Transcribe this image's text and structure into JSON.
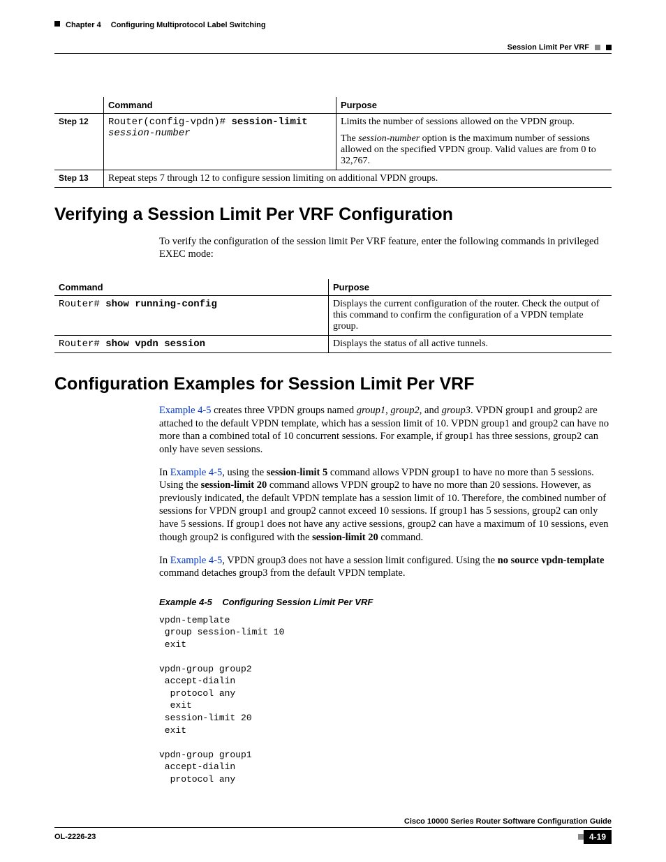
{
  "header": {
    "chapter": "Chapter 4",
    "title": "Configuring Multiprotocol Label Switching",
    "section": "Session Limit Per VRF"
  },
  "table1": {
    "headers": {
      "command": "Command",
      "purpose": "Purpose"
    },
    "rows": [
      {
        "step": "Step 12",
        "command_prefix": "Router(config-vpdn)# ",
        "command_bold": "session-limit",
        "command_italic": "session-number",
        "purpose_line1": "Limits the number of sessions allowed on the VPDN group.",
        "purpose_line2a": "The ",
        "purpose_line2b": "session-number",
        "purpose_line2c": " option is the maximum number of sessions allowed on the specified VPDN group. Valid values are from 0 to 32,767."
      },
      {
        "step": "Step 13",
        "merged": "Repeat steps 7 through 12 to configure session limiting on additional VPDN groups."
      }
    ]
  },
  "h2a": "Verifying a Session Limit Per VRF Configuration",
  "para1": "To verify the configuration of the session limit Per VRF feature, enter the following commands in privileged EXEC mode:",
  "table2": {
    "headers": {
      "command": "Command",
      "purpose": "Purpose"
    },
    "rows": [
      {
        "command_prefix": "Router# ",
        "command_bold": "show running-config",
        "purpose": "Displays the current configuration of the router. Check the output of this command to confirm the configuration of a VPDN template group."
      },
      {
        "command_prefix": "Router# ",
        "command_bold": "show vpdn session",
        "purpose": "Displays the status of all active tunnels."
      }
    ]
  },
  "h2b": "Configuration Examples for Session Limit Per VRF",
  "para2": {
    "link": "Example 4-5",
    "rest_a": " creates three VPDN groups named ",
    "i1": "group1",
    "c1": ", ",
    "i2": "group2",
    "c2": ", and ",
    "i3": "group3",
    "rest_b": ". VPDN group1 and group2 are attached to the default VPDN template, which has a session limit of 10. VPDN group1 and group2 can have no more than a combined total of 10 concurrent sessions. For example, if group1 has three sessions, group2 can only have seven sessions."
  },
  "para3": {
    "a": "In ",
    "link": "Example 4-5",
    "b": ", using the ",
    "bold1": "session-limit 5",
    "c": " command allows VPDN group1 to have no more than 5 sessions. Using the ",
    "bold2": "session-limit 20",
    "d": " command allows VPDN group2 to have no more than 20 sessions. However, as previously indicated, the default VPDN template has a session limit of 10. Therefore, the combined number of sessions for VPDN group1 and group2 cannot exceed 10 sessions. If group1 has 5 sessions, group2 can only have 5 sessions. If group1 does not have any active sessions, group2 can have a maximum of 10 sessions, even though group2 is configured with the ",
    "bold3": "session-limit 20",
    "e": " command."
  },
  "para4": {
    "a": "In ",
    "link": "Example 4-5",
    "b": ", VPDN group3 does not have a session limit configured. Using the ",
    "bold1": "no source vpdn-template",
    "c": " command detaches group3 from the default VPDN template."
  },
  "example": {
    "label": "Example 4-5",
    "title": "Configuring Session Limit Per VRF",
    "code": "vpdn-template\n group session-limit 10\n exit\n\nvpdn-group group2\n accept-dialin\n  protocol any\n  exit\n session-limit 20\n exit\n\nvpdn-group group1\n accept-dialin\n  protocol any"
  },
  "footer": {
    "book": "Cisco 10000 Series Router Software Configuration Guide",
    "doc": "OL-2226-23",
    "page": "4-19"
  }
}
